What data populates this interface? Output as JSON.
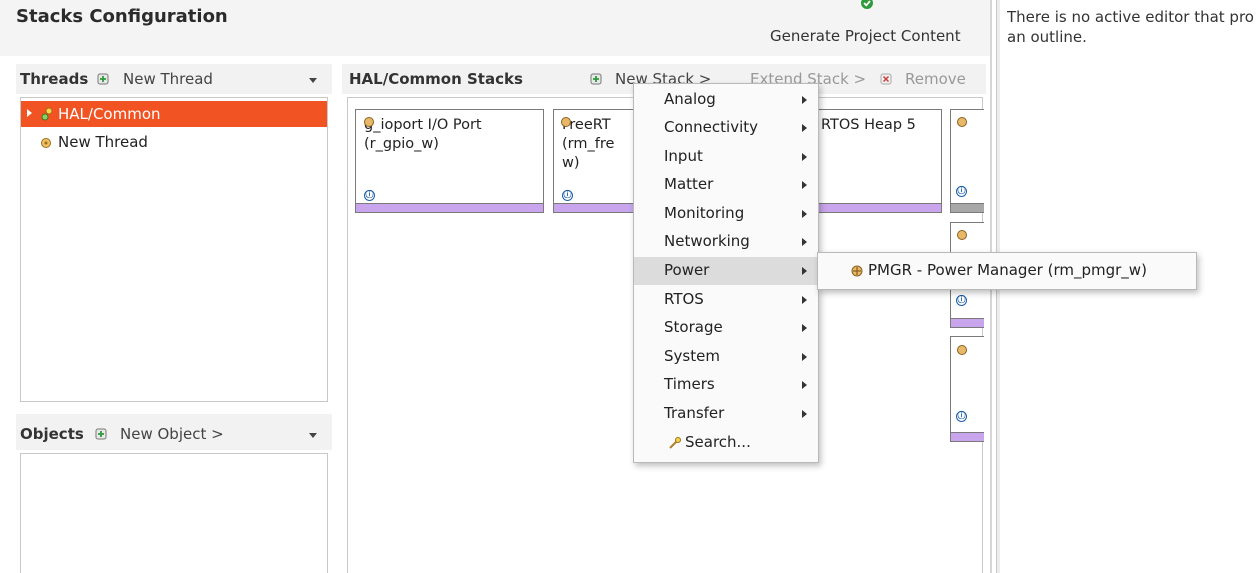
{
  "page": {
    "title": "Stacks Configuration",
    "generate_label": "Generate Project Content",
    "outline_message_line1": "There is no active editor that pro",
    "outline_message_line2": "an outline."
  },
  "threads": {
    "title": "Threads",
    "new_thread_label": "New Thread",
    "items": [
      {
        "label": "HAL/Common",
        "selected": true
      },
      {
        "label": "New Thread",
        "selected": false
      }
    ]
  },
  "objects": {
    "title": "Objects",
    "new_object_label": "New Object >"
  },
  "stacks": {
    "title": "HAL/Common Stacks",
    "new_stack_label": "New Stack >",
    "extend_stack_label": "Extend Stack >",
    "remove_label": "Remove",
    "cards": [
      {
        "line1": "g_ioport I/O Port",
        "line2": "(r_gpio_w)"
      },
      {
        "line1": "FreeRT",
        "line2": "(rm_fre",
        "line3": "w)"
      },
      {
        "line1": "RTOS Heap 5"
      }
    ],
    "info_glyph": "ⓘ"
  },
  "context_menu": {
    "items": [
      {
        "label": "Analog",
        "has_submenu": true
      },
      {
        "label": "Connectivity",
        "has_submenu": true
      },
      {
        "label": "Input",
        "has_submenu": true
      },
      {
        "label": "Matter",
        "has_submenu": true
      },
      {
        "label": "Monitoring",
        "has_submenu": true
      },
      {
        "label": "Networking",
        "has_submenu": true
      },
      {
        "label": "Power",
        "has_submenu": true,
        "highlighted": true
      },
      {
        "label": "RTOS",
        "has_submenu": true
      },
      {
        "label": "Storage",
        "has_submenu": true
      },
      {
        "label": "System",
        "has_submenu": true
      },
      {
        "label": "Timers",
        "has_submenu": true
      },
      {
        "label": "Transfer",
        "has_submenu": true
      },
      {
        "label": "Search...",
        "has_submenu": false
      }
    ],
    "submenu": {
      "items": [
        {
          "label": "PMGR - Power Manager (rm_pmgr_w)"
        }
      ]
    }
  },
  "colors": {
    "selection": "#f25322",
    "card_bar": "#c8a5ec",
    "check": "#2e9b3a",
    "info": "#1d5fa8"
  }
}
